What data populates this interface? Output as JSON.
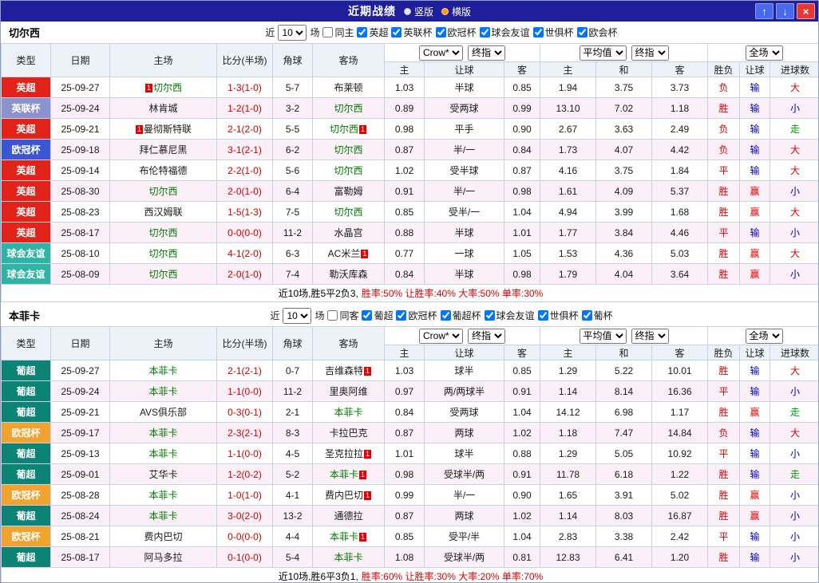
{
  "titlebar": {
    "title": "近期战绩",
    "radios": [
      {
        "label": "竖版",
        "selected": false
      },
      {
        "label": "横版",
        "selected": true
      }
    ],
    "up_icon": "↑",
    "down_icon": "↓",
    "close_icon": "×"
  },
  "filter": {
    "prefix": "近",
    "count": "10",
    "suffix": "场"
  },
  "table_header": {
    "left_columns": [
      "类型",
      "日期",
      "主场",
      "比分(半场)",
      "角球",
      "客场"
    ],
    "group1_dropdowns": [
      "Crow*",
      "终指"
    ],
    "group1_labels": [
      "主",
      "让球",
      "客"
    ],
    "group2_dropdowns": [
      "平均值",
      "终指"
    ],
    "group2_labels": [
      "主",
      "和",
      "客"
    ],
    "group3_dropdowns": [
      "全场"
    ],
    "group3_labels": [
      "胜负",
      "让球",
      "进球数"
    ]
  },
  "colors": {
    "topbar": "#1f1f9e",
    "accent_red": "#e60000",
    "accent_blue": "#0000cc",
    "accent_green": "#009900",
    "focus_team": "#007a00"
  },
  "sections": [
    {
      "team": "切尔西",
      "checkboxes": [
        {
          "label": "同主",
          "checked": false
        },
        {
          "label": "英超",
          "checked": true
        },
        {
          "label": "英联杯",
          "checked": true
        },
        {
          "label": "欧冠杯",
          "checked": true
        },
        {
          "label": "球会友谊",
          "checked": true
        },
        {
          "label": "世俱杯",
          "checked": true
        },
        {
          "label": "欧会杯",
          "checked": true
        }
      ],
      "rows": [
        {
          "type": "英超",
          "type_color": "#e2231a",
          "date": "25-09-27",
          "home": "切尔西",
          "home_focus": true,
          "home_card": "1",
          "score": "1-3(1-0)",
          "corners": "5-7",
          "away": "布莱顿",
          "away_focus": false,
          "away_card": "",
          "odds": [
            "1.03",
            "半球",
            "0.85"
          ],
          "avg": [
            "1.94",
            "3.75",
            "3.73"
          ],
          "res": [
            [
              "负",
              "r"
            ],
            [
              "输",
              "b"
            ],
            [
              "大",
              "r"
            ]
          ]
        },
        {
          "type": "英联杯",
          "type_color": "#8a93ce",
          "date": "25-09-24",
          "home": "林肯城",
          "home_focus": false,
          "home_card": "",
          "score": "1-2(1-0)",
          "corners": "3-2",
          "away": "切尔西",
          "away_focus": true,
          "away_card": "",
          "odds": [
            "0.89",
            "受两球",
            "0.99"
          ],
          "avg": [
            "13.10",
            "7.02",
            "1.18"
          ],
          "res": [
            [
              "胜",
              "r"
            ],
            [
              "输",
              "b"
            ],
            [
              "小",
              "b"
            ]
          ]
        },
        {
          "type": "英超",
          "type_color": "#e2231a",
          "date": "25-09-21",
          "home": "曼彻斯特联",
          "home_focus": false,
          "home_card": "1",
          "score": "2-1(2-0)",
          "corners": "5-5",
          "away": "切尔西",
          "away_focus": true,
          "away_card": "1",
          "odds": [
            "0.98",
            "平手",
            "0.90"
          ],
          "avg": [
            "2.67",
            "3.63",
            "2.49"
          ],
          "res": [
            [
              "负",
              "r"
            ],
            [
              "输",
              "b"
            ],
            [
              "走",
              "g"
            ]
          ]
        },
        {
          "type": "欧冠杯",
          "type_color": "#3b56d4",
          "date": "25-09-18",
          "home": "拜仁慕尼黑",
          "home_focus": false,
          "home_card": "",
          "score": "3-1(2-1)",
          "corners": "6-2",
          "away": "切尔西",
          "away_focus": true,
          "away_card": "",
          "odds": [
            "0.87",
            "半/一",
            "0.84"
          ],
          "avg": [
            "1.73",
            "4.07",
            "4.42"
          ],
          "res": [
            [
              "负",
              "r"
            ],
            [
              "输",
              "b"
            ],
            [
              "大",
              "r"
            ]
          ]
        },
        {
          "type": "英超",
          "type_color": "#e2231a",
          "date": "25-09-14",
          "home": "布伦特福德",
          "home_focus": false,
          "home_card": "",
          "score": "2-2(1-0)",
          "corners": "5-6",
          "away": "切尔西",
          "away_focus": true,
          "away_card": "",
          "odds": [
            "1.02",
            "受半球",
            "0.87"
          ],
          "avg": [
            "4.16",
            "3.75",
            "1.84"
          ],
          "res": [
            [
              "平",
              "r"
            ],
            [
              "输",
              "b"
            ],
            [
              "大",
              "r"
            ]
          ]
        },
        {
          "type": "英超",
          "type_color": "#e2231a",
          "date": "25-08-30",
          "home": "切尔西",
          "home_focus": true,
          "home_card": "",
          "score": "2-0(1-0)",
          "corners": "6-4",
          "away": "富勒姆",
          "away_focus": false,
          "away_card": "",
          "odds": [
            "0.91",
            "半/一",
            "0.98"
          ],
          "avg": [
            "1.61",
            "4.09",
            "5.37"
          ],
          "res": [
            [
              "胜",
              "r"
            ],
            [
              "赢",
              "r"
            ],
            [
              "小",
              "b"
            ]
          ]
        },
        {
          "type": "英超",
          "type_color": "#e2231a",
          "date": "25-08-23",
          "home": "西汉姆联",
          "home_focus": false,
          "home_card": "",
          "score": "1-5(1-3)",
          "corners": "7-5",
          "away": "切尔西",
          "away_focus": true,
          "away_card": "",
          "odds": [
            "0.85",
            "受半/一",
            "1.04"
          ],
          "avg": [
            "4.94",
            "3.99",
            "1.68"
          ],
          "res": [
            [
              "胜",
              "r"
            ],
            [
              "赢",
              "r"
            ],
            [
              "大",
              "r"
            ]
          ]
        },
        {
          "type": "英超",
          "type_color": "#e2231a",
          "date": "25-08-17",
          "home": "切尔西",
          "home_focus": true,
          "home_card": "",
          "score": "0-0(0-0)",
          "corners": "11-2",
          "away": "水晶宫",
          "away_focus": false,
          "away_card": "",
          "odds": [
            "0.88",
            "半球",
            "1.01"
          ],
          "avg": [
            "1.77",
            "3.84",
            "4.46"
          ],
          "res": [
            [
              "平",
              "r"
            ],
            [
              "输",
              "b"
            ],
            [
              "小",
              "b"
            ]
          ]
        },
        {
          "type": "球会友谊",
          "type_color": "#2eb3a4",
          "date": "25-08-10",
          "home": "切尔西",
          "home_focus": true,
          "home_card": "",
          "score": "4-1(2-0)",
          "corners": "6-3",
          "away": "AC米兰",
          "away_focus": false,
          "away_card": "1",
          "odds": [
            "0.77",
            "一球",
            "1.05"
          ],
          "avg": [
            "1.53",
            "4.36",
            "5.03"
          ],
          "res": [
            [
              "胜",
              "r"
            ],
            [
              "赢",
              "r"
            ],
            [
              "大",
              "r"
            ]
          ]
        },
        {
          "type": "球会友谊",
          "type_color": "#2eb3a4",
          "date": "25-08-09",
          "home": "切尔西",
          "home_focus": true,
          "home_card": "",
          "score": "2-0(1-0)",
          "corners": "7-4",
          "away": "勒沃库森",
          "away_focus": false,
          "away_card": "",
          "odds": [
            "0.84",
            "半球",
            "0.98"
          ],
          "avg": [
            "1.79",
            "4.04",
            "3.64"
          ],
          "res": [
            [
              "胜",
              "r"
            ],
            [
              "赢",
              "r"
            ],
            [
              "小",
              "b"
            ]
          ]
        }
      ],
      "summary_black": "近10场,胜5平2负3,",
      "summary_red": "胜率:50% 让胜率:40% 大率:50% 单率:30%"
    },
    {
      "team": "本菲卡",
      "checkboxes": [
        {
          "label": "同客",
          "checked": false
        },
        {
          "label": "葡超",
          "checked": true
        },
        {
          "label": "欧冠杯",
          "checked": true
        },
        {
          "label": "葡超杯",
          "checked": true
        },
        {
          "label": "球会友谊",
          "checked": true
        },
        {
          "label": "世俱杯",
          "checked": true
        },
        {
          "label": "葡杯",
          "checked": true
        }
      ],
      "rows": [
        {
          "type": "葡超",
          "type_color": "#0c8374",
          "date": "25-09-27",
          "home": "本菲卡",
          "home_focus": true,
          "home_card": "",
          "score": "2-1(2-1)",
          "corners": "0-7",
          "away": "吉维森特",
          "away_focus": false,
          "away_card": "1",
          "odds": [
            "1.03",
            "球半",
            "0.85"
          ],
          "avg": [
            "1.29",
            "5.22",
            "10.01"
          ],
          "res": [
            [
              "胜",
              "r"
            ],
            [
              "输",
              "b"
            ],
            [
              "大",
              "r"
            ]
          ]
        },
        {
          "type": "葡超",
          "type_color": "#0c8374",
          "date": "25-09-24",
          "home": "本菲卡",
          "home_focus": true,
          "home_card": "",
          "score": "1-1(0-0)",
          "corners": "11-2",
          "away": "里奥阿维",
          "away_focus": false,
          "away_card": "",
          "odds": [
            "0.97",
            "两/两球半",
            "0.91"
          ],
          "avg": [
            "1.14",
            "8.14",
            "16.36"
          ],
          "res": [
            [
              "平",
              "r"
            ],
            [
              "输",
              "b"
            ],
            [
              "小",
              "b"
            ]
          ]
        },
        {
          "type": "葡超",
          "type_color": "#0c8374",
          "date": "25-09-21",
          "home": "AVS俱乐部",
          "home_focus": false,
          "home_card": "",
          "score": "0-3(0-1)",
          "corners": "2-1",
          "away": "本菲卡",
          "away_focus": true,
          "away_card": "",
          "odds": [
            "0.84",
            "受两球",
            "1.04"
          ],
          "avg": [
            "14.12",
            "6.98",
            "1.17"
          ],
          "res": [
            [
              "胜",
              "r"
            ],
            [
              "赢",
              "r"
            ],
            [
              "走",
              "g"
            ]
          ]
        },
        {
          "type": "欧冠杯",
          "type_color": "#f0a32f",
          "date": "25-09-17",
          "home": "本菲卡",
          "home_focus": true,
          "home_card": "",
          "score": "2-3(2-1)",
          "corners": "8-3",
          "away": "卡拉巴克",
          "away_focus": false,
          "away_card": "",
          "odds": [
            "0.87",
            "两球",
            "1.02"
          ],
          "avg": [
            "1.18",
            "7.47",
            "14.84"
          ],
          "res": [
            [
              "负",
              "r"
            ],
            [
              "输",
              "b"
            ],
            [
              "大",
              "r"
            ]
          ]
        },
        {
          "type": "葡超",
          "type_color": "#0c8374",
          "date": "25-09-13",
          "home": "本菲卡",
          "home_focus": true,
          "home_card": "",
          "score": "1-1(0-0)",
          "corners": "4-5",
          "away": "圣克拉拉",
          "away_focus": false,
          "away_card": "1",
          "odds": [
            "1.01",
            "球半",
            "0.88"
          ],
          "avg": [
            "1.29",
            "5.05",
            "10.92"
          ],
          "res": [
            [
              "平",
              "r"
            ],
            [
              "输",
              "b"
            ],
            [
              "小",
              "b"
            ]
          ]
        },
        {
          "type": "葡超",
          "type_color": "#0c8374",
          "date": "25-09-01",
          "home": "艾华卡",
          "home_focus": false,
          "home_card": "",
          "score": "1-2(0-2)",
          "corners": "5-2",
          "away": "本菲卡",
          "away_focus": true,
          "away_card": "1",
          "odds": [
            "0.98",
            "受球半/两",
            "0.91"
          ],
          "avg": [
            "11.78",
            "6.18",
            "1.22"
          ],
          "res": [
            [
              "胜",
              "r"
            ],
            [
              "输",
              "b"
            ],
            [
              "走",
              "g"
            ]
          ]
        },
        {
          "type": "欧冠杯",
          "type_color": "#f0a32f",
          "date": "25-08-28",
          "home": "本菲卡",
          "home_focus": true,
          "home_card": "",
          "score": "1-0(1-0)",
          "corners": "4-1",
          "away": "费内巴切",
          "away_focus": false,
          "away_card": "1",
          "odds": [
            "0.99",
            "半/一",
            "0.90"
          ],
          "avg": [
            "1.65",
            "3.91",
            "5.02"
          ],
          "res": [
            [
              "胜",
              "r"
            ],
            [
              "赢",
              "r"
            ],
            [
              "小",
              "b"
            ]
          ]
        },
        {
          "type": "葡超",
          "type_color": "#0c8374",
          "date": "25-08-24",
          "home": "本菲卡",
          "home_focus": true,
          "home_card": "",
          "score": "3-0(2-0)",
          "corners": "13-2",
          "away": "通德拉",
          "away_focus": false,
          "away_card": "",
          "odds": [
            "0.87",
            "两球",
            "1.02"
          ],
          "avg": [
            "1.14",
            "8.03",
            "16.87"
          ],
          "res": [
            [
              "胜",
              "r"
            ],
            [
              "赢",
              "r"
            ],
            [
              "小",
              "b"
            ]
          ]
        },
        {
          "type": "欧冠杯",
          "type_color": "#f0a32f",
          "date": "25-08-21",
          "home": "费内巴切",
          "home_focus": false,
          "home_card": "",
          "score": "0-0(0-0)",
          "corners": "4-4",
          "away": "本菲卡",
          "away_focus": true,
          "away_card": "1",
          "odds": [
            "0.85",
            "受平/半",
            "1.04"
          ],
          "avg": [
            "2.83",
            "3.38",
            "2.42"
          ],
          "res": [
            [
              "平",
              "r"
            ],
            [
              "输",
              "b"
            ],
            [
              "小",
              "b"
            ]
          ]
        },
        {
          "type": "葡超",
          "type_color": "#0c8374",
          "date": "25-08-17",
          "home": "阿马多拉",
          "home_focus": false,
          "home_card": "",
          "score": "0-1(0-0)",
          "corners": "5-4",
          "away": "本菲卡",
          "away_focus": true,
          "away_card": "",
          "odds": [
            "1.08",
            "受球半/两",
            "0.81"
          ],
          "avg": [
            "12.83",
            "6.41",
            "1.20"
          ],
          "res": [
            [
              "胜",
              "r"
            ],
            [
              "输",
              "b"
            ],
            [
              "小",
              "b"
            ]
          ]
        }
      ],
      "summary_black": "近10场,胜6平3负1,",
      "summary_red": "胜率:60% 让胜率:30% 大率:20% 单率:70%"
    }
  ]
}
